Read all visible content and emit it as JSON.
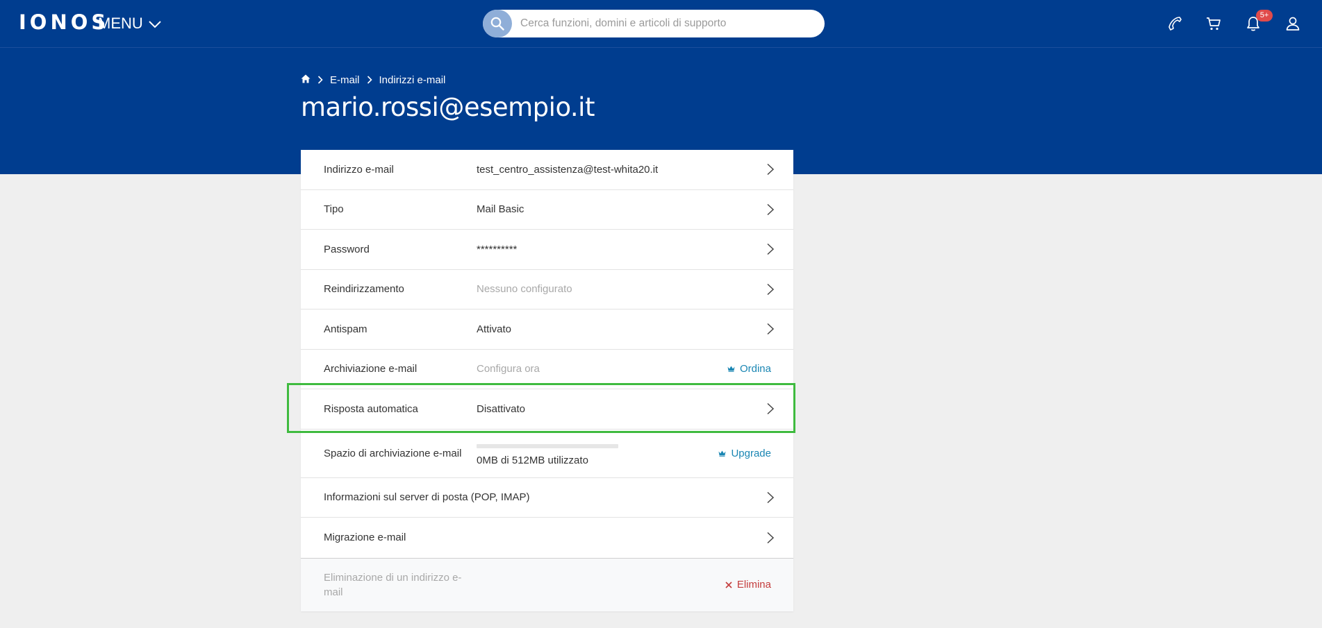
{
  "header": {
    "logo_text": "IONOS",
    "menu_label": "MENU",
    "search_placeholder": "Cerca funzioni, domini e articoli di supporto",
    "notification_badge": "5+",
    "icons": [
      "phone-icon",
      "cart-icon",
      "bell-icon",
      "user-icon"
    ]
  },
  "breadcrumb": {
    "home_icon": "home-icon",
    "items": [
      "E-mail",
      "Indirizzi e-mail"
    ]
  },
  "page_title": "mario.rossi@esempio.it",
  "settings": {
    "rows": [
      {
        "label": "Indirizzo e-mail",
        "value": "test_centro_assistenza@test-whita20.it"
      },
      {
        "label": "Tipo",
        "value": "Mail Basic"
      },
      {
        "label": "Password",
        "value": "**********"
      },
      {
        "label": "Reindirizzamento",
        "value": "Nessuno configurato"
      },
      {
        "label": "Antispam",
        "value": "Attivato"
      },
      {
        "label": "Archiviazione e-mail",
        "value": "Configura ora",
        "action": "Ordina"
      },
      {
        "label": "Risposta automatica",
        "value": "Disattivato"
      },
      {
        "label": "Spazio di archiviazione e-mail",
        "value": "0MB di 512MB utilizzato",
        "action": "Upgrade",
        "usage_fraction": 0
      },
      {
        "label": "Informazioni sul server di posta (POP, IMAP)"
      },
      {
        "label": "Migrazione e-mail"
      }
    ],
    "delete": {
      "label": "Eliminazione di un indirizzo e-mail",
      "action": "Elimina"
    }
  },
  "colors": {
    "brand_blue": "#003d8f",
    "link": "#1a86b3",
    "danger": "#c43d3d",
    "highlight": "#3fbb3f"
  }
}
